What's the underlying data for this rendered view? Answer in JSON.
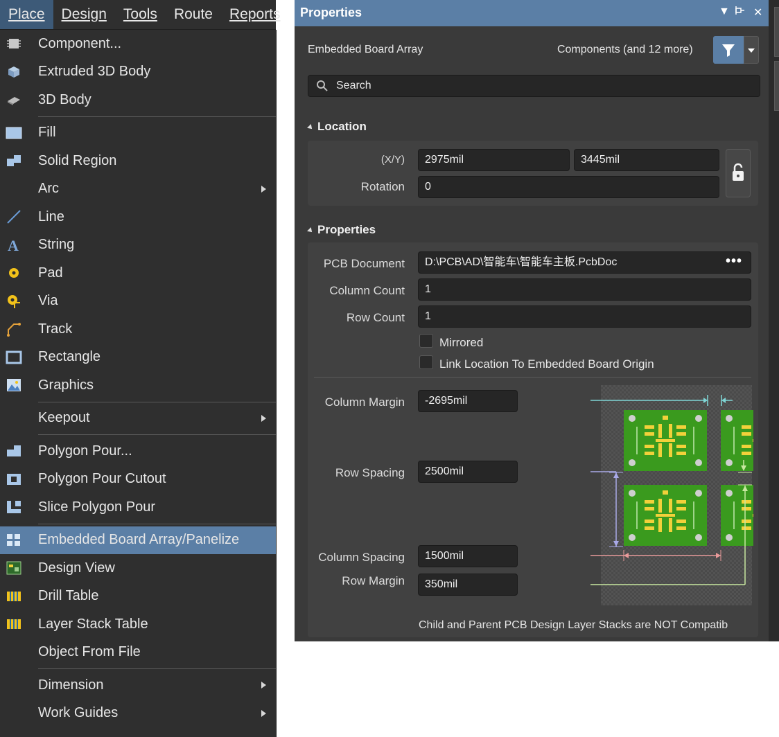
{
  "menubar": {
    "items": [
      {
        "label": "Place"
      },
      {
        "label": "Design"
      },
      {
        "label": "Tools"
      },
      {
        "label": "Route"
      },
      {
        "label": "Reports"
      }
    ]
  },
  "menu": {
    "items": [
      {
        "label": "Component...",
        "icon": "component-icon"
      },
      {
        "label": "Extruded 3D Body",
        "icon": "extruded-3d-body-icon"
      },
      {
        "label": "3D Body",
        "icon": "3d-body-icon"
      },
      {
        "label": "Fill",
        "icon": "fill-icon"
      },
      {
        "label": "Solid Region",
        "icon": "solid-region-icon"
      },
      {
        "label": "Arc",
        "icon": "",
        "submenu": true
      },
      {
        "label": "Line",
        "icon": "line-icon"
      },
      {
        "label": "String",
        "icon": "string-icon"
      },
      {
        "label": "Pad",
        "icon": "pad-icon"
      },
      {
        "label": "Via",
        "icon": "via-icon"
      },
      {
        "label": "Track",
        "icon": "track-icon"
      },
      {
        "label": "Rectangle",
        "icon": "rectangle-icon"
      },
      {
        "label": "Graphics",
        "icon": "graphics-icon"
      },
      {
        "label": "Keepout",
        "icon": "",
        "submenu": true
      },
      {
        "label": "Polygon Pour...",
        "icon": "polygon-pour-icon"
      },
      {
        "label": "Polygon Pour Cutout",
        "icon": "polygon-pour-cutout-icon"
      },
      {
        "label": "Slice Polygon Pour",
        "icon": "slice-polygon-pour-icon"
      },
      {
        "label": "Embedded Board Array/Panelize",
        "icon": "embedded-board-array-icon",
        "selected": true
      },
      {
        "label": "Design View",
        "icon": "design-view-icon"
      },
      {
        "label": "Drill Table",
        "icon": "drill-table-icon"
      },
      {
        "label": "Layer Stack Table",
        "icon": "layer-stack-table-icon"
      },
      {
        "label": "Object From File",
        "icon": ""
      },
      {
        "label": "Dimension",
        "icon": "",
        "submenu": true
      },
      {
        "label": "Work Guides",
        "icon": "",
        "submenu": true
      }
    ]
  },
  "panel": {
    "title": "Properties",
    "object_type": "Embedded Board Array",
    "filter_text": "Components (and 12 more)",
    "search_placeholder": "Search",
    "location": {
      "heading": "Location",
      "xy_label": "(X/Y)",
      "x_value": "2975mil",
      "y_value": "3445mil",
      "rotation_label": "Rotation",
      "rotation_value": "0"
    },
    "properties": {
      "heading": "Properties",
      "pcb_document_label": "PCB Document",
      "pcb_document_value": "D:\\PCB\\AD\\智能车\\智能车主板.PcbDoc",
      "column_count_label": "Column Count",
      "column_count_value": "1",
      "row_count_label": "Row Count",
      "row_count_value": "1",
      "mirrored_label": "Mirrored",
      "link_location_label": "Link Location To Embedded Board Origin",
      "column_margin_label": "Column Margin",
      "column_margin_value": "-2695mil",
      "row_spacing_label": "Row Spacing",
      "row_spacing_value": "2500mil",
      "column_spacing_label": "Column Spacing",
      "column_spacing_value": "1500mil",
      "row_margin_label": "Row Margin",
      "row_margin_value": "350mil",
      "warning": "Child and Parent PCB Design Layer Stacks are NOT Compatib"
    }
  },
  "colors": {
    "accent": "#5b7fa6",
    "panel_bg": "#3a3a3a",
    "menu_bg": "#2f2f2f",
    "board_green": "#3a9a1e",
    "pad_yellow": "#f2d13a"
  }
}
